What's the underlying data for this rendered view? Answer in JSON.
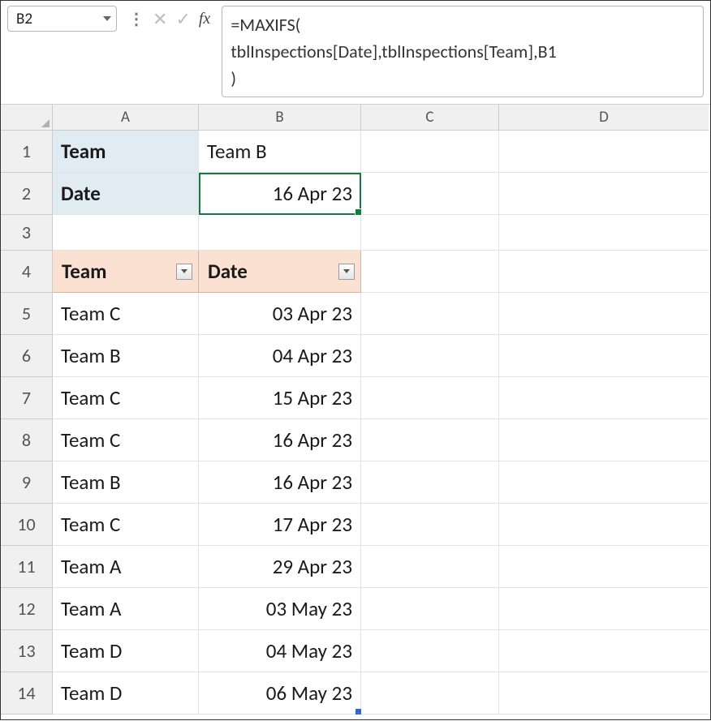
{
  "namebox": {
    "value": "B2"
  },
  "fx_label": "fx",
  "formula": "=MAXIFS(\ntblInspections[Date],tblInspections[Team],B1\n)",
  "columns": [
    "A",
    "B",
    "C",
    "D"
  ],
  "row_numbers": [
    "1",
    "2",
    "3",
    "4",
    "5",
    "6",
    "7",
    "8",
    "9",
    "10",
    "11",
    "12",
    "13",
    "14"
  ],
  "lookup": {
    "team_label": "Team",
    "team_value": "Team B",
    "date_label": "Date",
    "date_value": "16 Apr 23"
  },
  "table": {
    "headers": {
      "team": "Team",
      "date": "Date"
    },
    "rows": [
      {
        "team": "Team C",
        "date": "03 Apr 23"
      },
      {
        "team": "Team B",
        "date": "04 Apr 23"
      },
      {
        "team": "Team C",
        "date": "15 Apr 23"
      },
      {
        "team": "Team C",
        "date": "16 Apr 23"
      },
      {
        "team": "Team B",
        "date": "16 Apr 23"
      },
      {
        "team": "Team C",
        "date": "17 Apr 23"
      },
      {
        "team": "Team A",
        "date": "29 Apr 23"
      },
      {
        "team": "Team A",
        "date": "03 May 23"
      },
      {
        "team": "Team D",
        "date": "04 May 23"
      },
      {
        "team": "Team D",
        "date": "06 May 23"
      }
    ]
  }
}
